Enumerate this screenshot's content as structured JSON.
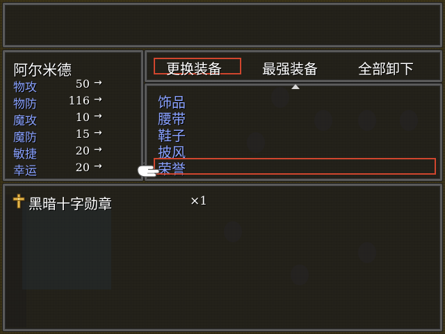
{
  "actor": {
    "name": "阿尔米德",
    "stats": [
      {
        "label": "物攻",
        "value": "50",
        "arrow": "→"
      },
      {
        "label": "物防",
        "value": "116",
        "arrow": "→"
      },
      {
        "label": "魔攻",
        "value": "10",
        "arrow": "→"
      },
      {
        "label": "魔防",
        "value": "15",
        "arrow": "→"
      },
      {
        "label": "敏捷",
        "value": "20",
        "arrow": "→"
      },
      {
        "label": "幸运",
        "value": "20",
        "arrow": "→"
      }
    ]
  },
  "commands": {
    "items": [
      "更换装备",
      "最强装备",
      "全部卸下"
    ],
    "selected_index": 0
  },
  "equip_slots": {
    "items": [
      "饰品",
      "腰带",
      "鞋子",
      "披风",
      "荣誉"
    ],
    "selected_index": 4
  },
  "item_list": {
    "items": [
      {
        "name": "黑暗十字勋章",
        "qty": "×1",
        "icon": "cross-medal-icon"
      }
    ]
  },
  "colors": {
    "system_label": "#8aa2ff",
    "cursor_border": "#d2462e",
    "window_border": "#5a5a5a"
  }
}
